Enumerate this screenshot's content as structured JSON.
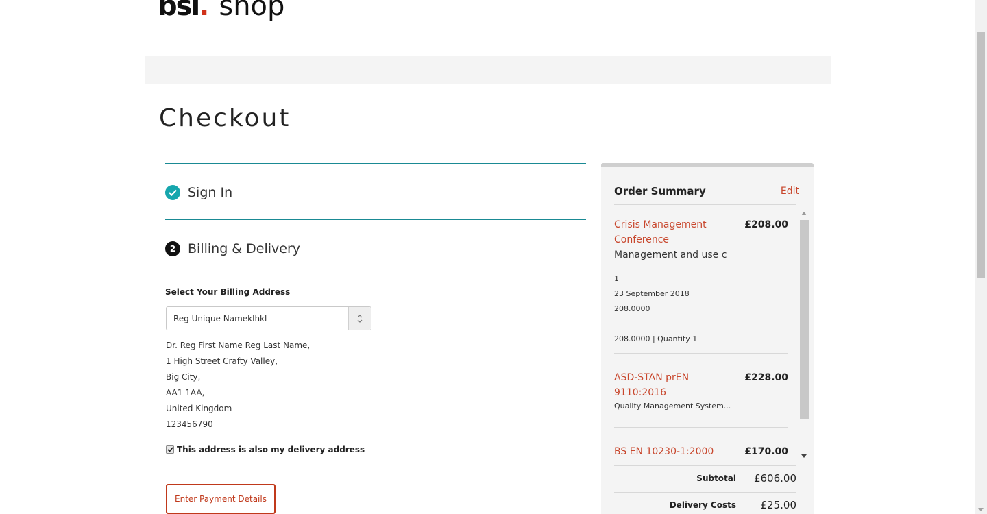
{
  "header": {
    "logo_main": "bsi",
    "logo_dot": ".",
    "logo_shop": "shop"
  },
  "page": {
    "title": "Checkout"
  },
  "steps": {
    "sign_in": {
      "label": "Sign In",
      "icon": "check-icon"
    },
    "billing": {
      "label": "Billing & Delivery",
      "number": "2"
    }
  },
  "billing": {
    "select_label": "Select Your Billing Address",
    "selected_address": "Reg Unique Nameklhkl",
    "address_lines": [
      "Dr. Reg First Name Reg Last Name,",
      "1 High Street Crafty Valley,",
      "Big City,",
      "AA1 1AA,",
      "United Kingdom",
      "123456790"
    ],
    "delivery_checkbox_label": "This address is also my delivery address",
    "delivery_checked": true,
    "payment_button": "Enter Payment Details"
  },
  "summary": {
    "title": "Order Summary",
    "edit_label": "Edit",
    "items": [
      {
        "name": "Crisis Management Conference",
        "price": "£208.00",
        "description": "Management and use c",
        "quantity": "1",
        "date": "23 September 2018",
        "unit_price": "208.0000",
        "price_qty": "208.0000 | Quantity 1"
      },
      {
        "name": "ASD-STAN prEN 9110:2016",
        "price": "£228.00",
        "description": "Quality Management System..."
      },
      {
        "name": "BS EN 10230-1:2000",
        "price": "£170.00"
      }
    ],
    "subtotal_label": "Subtotal",
    "subtotal_value": "£606.00",
    "delivery_label": "Delivery Costs",
    "delivery_value": "£25.00"
  },
  "colors": {
    "accent": "#c8462c",
    "teal": "#16a6ad",
    "step_line": "#1a8a94"
  }
}
